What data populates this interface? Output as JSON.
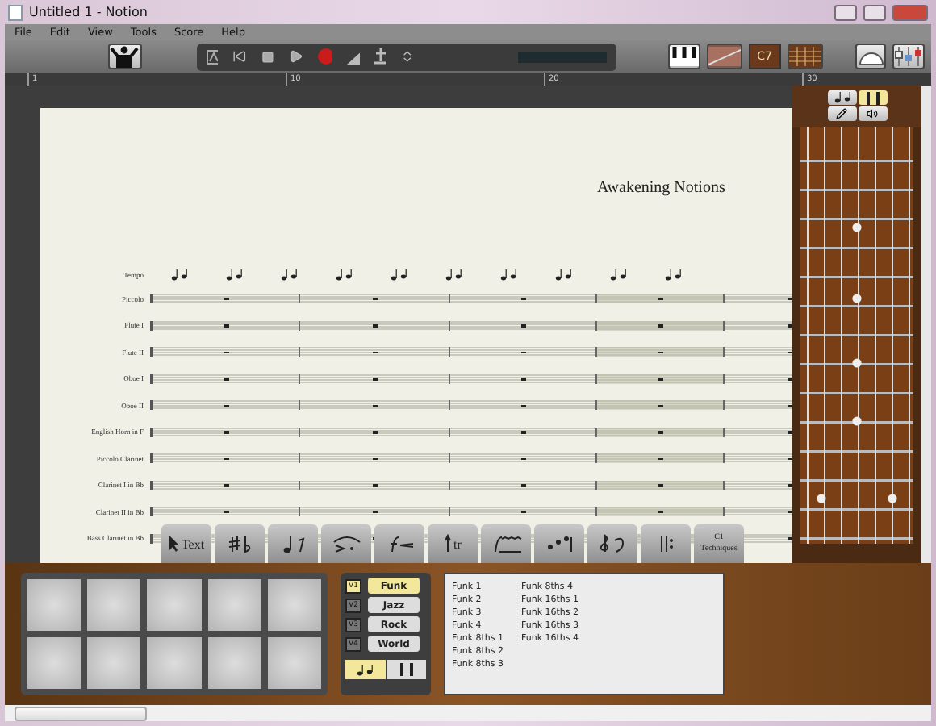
{
  "window": {
    "title": "Untitled 1 - Notion"
  },
  "menu": [
    "File",
    "Edit",
    "View",
    "Tools",
    "Score",
    "Help"
  ],
  "toolbar": {
    "chord_label": "C7"
  },
  "ruler": [
    "1",
    "10",
    "20",
    "30"
  ],
  "score": {
    "title": "Awakening Notions",
    "staves": [
      {
        "name": "Tempo",
        "kind": "tempo"
      },
      {
        "name": "Piccolo",
        "kind": "staff"
      },
      {
        "name": "Flute I",
        "kind": "staff"
      },
      {
        "name": "Flute II",
        "kind": "staff"
      },
      {
        "name": "Oboe I",
        "kind": "staff"
      },
      {
        "name": "Oboe II",
        "kind": "staff"
      },
      {
        "name": "English Horn in F",
        "kind": "staff"
      },
      {
        "name": "Piccolo Clarinet",
        "kind": "staff"
      },
      {
        "name": "Clarinet I in Bb",
        "kind": "staff"
      },
      {
        "name": "Clarinet II in Bb",
        "kind": "staff"
      },
      {
        "name": "Bass Clarinet in Bb",
        "kind": "staff"
      }
    ]
  },
  "palette": [
    {
      "kind": "text",
      "label": "Text"
    },
    {
      "kind": "accidentals"
    },
    {
      "kind": "notes"
    },
    {
      "kind": "articulations"
    },
    {
      "kind": "dynamics"
    },
    {
      "kind": "trill",
      "label": "tr"
    },
    {
      "kind": "glissando"
    },
    {
      "kind": "tuplets"
    },
    {
      "kind": "clefs"
    },
    {
      "kind": "repeats"
    },
    {
      "kind": "techniques",
      "label": "C1",
      "sublabel": "Techniques"
    }
  ],
  "fretboard": {
    "modes": [
      {
        "kind": "notes",
        "selected": false
      },
      {
        "kind": "tab",
        "selected": true
      }
    ],
    "tools": [
      {
        "kind": "pencil"
      },
      {
        "kind": "speaker"
      }
    ]
  },
  "drum_panel": {
    "voices": [
      {
        "label": "V1",
        "selected": true
      },
      {
        "label": "V2",
        "selected": false
      },
      {
        "label": "V3",
        "selected": false
      },
      {
        "label": "V4",
        "selected": false
      }
    ],
    "styles": [
      {
        "label": "Funk",
        "selected": true
      },
      {
        "label": "Jazz",
        "selected": false
      },
      {
        "label": "Rock",
        "selected": false
      },
      {
        "label": "World",
        "selected": false
      }
    ],
    "rhythm_modes": [
      {
        "kind": "notes",
        "selected": true
      },
      {
        "kind": "stacked",
        "selected": false
      }
    ],
    "patterns": [
      "Funk 1",
      "Funk 2",
      "Funk 3",
      "Funk 4",
      "Funk 8ths 1",
      "Funk 8ths 2",
      "Funk 8ths 3",
      "Funk 8ths 4",
      "Funk 16ths 1",
      "Funk 16ths 2",
      "Funk 16ths 3",
      "Funk 16ths 4"
    ]
  }
}
